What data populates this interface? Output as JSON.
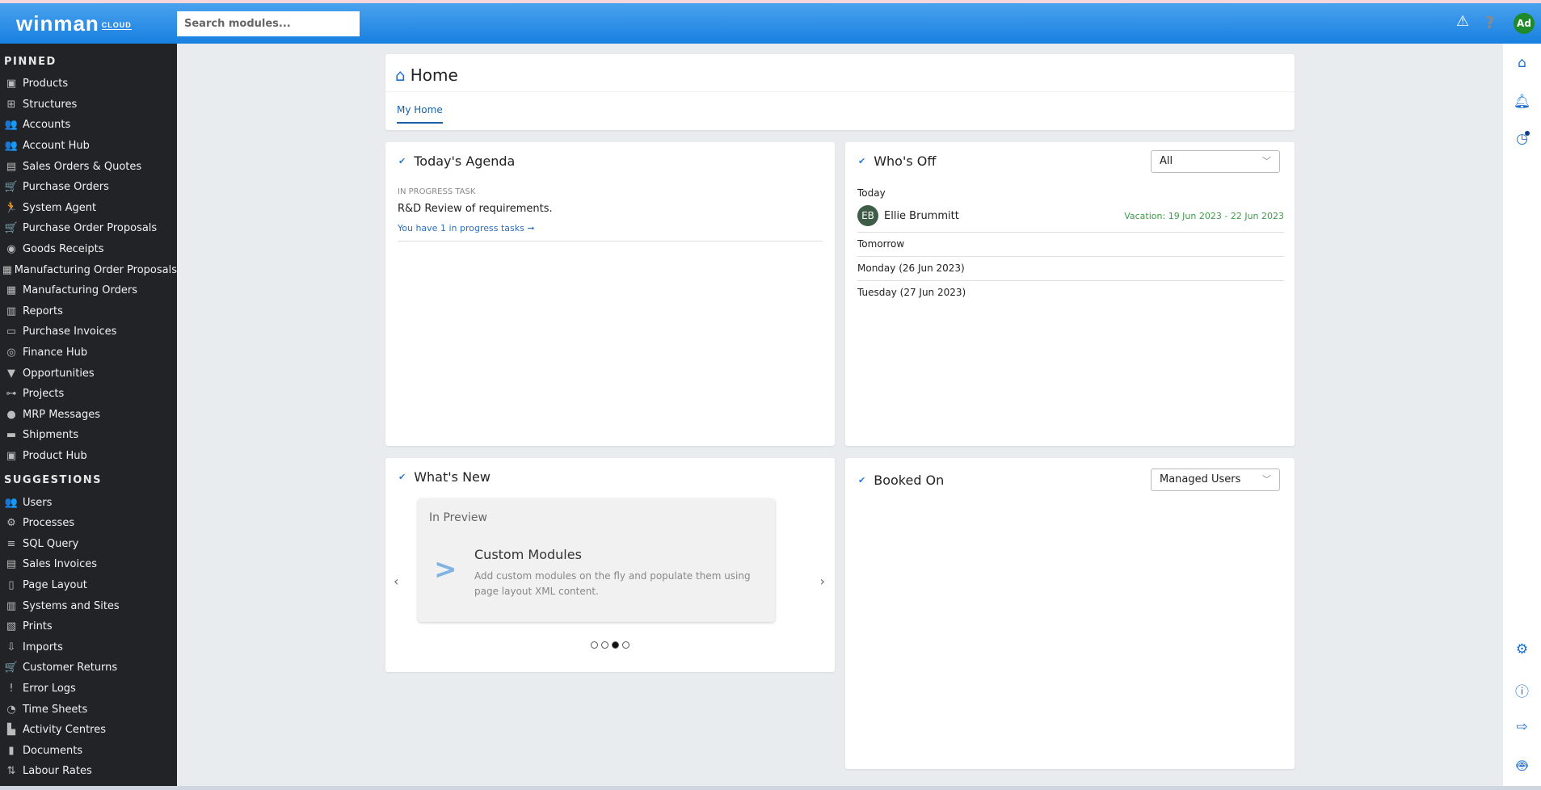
{
  "header": {
    "logo": "winman",
    "logo_sub": "CLOUD",
    "search_placeholder": "Search modules...",
    "avatar": "Ad",
    "icons": [
      "warning-icon",
      "help-icon"
    ]
  },
  "sidebar": {
    "pinned_label": "PINNED",
    "pinned": [
      {
        "label": "Products",
        "icon": "▣"
      },
      {
        "label": "Structures",
        "icon": "⊞"
      },
      {
        "label": "Accounts",
        "icon": "👥"
      },
      {
        "label": "Account Hub",
        "icon": "👥"
      },
      {
        "label": "Sales Orders & Quotes",
        "icon": "▤"
      },
      {
        "label": "Purchase Orders",
        "icon": "🛒"
      },
      {
        "label": "System Agent",
        "icon": "🏃"
      },
      {
        "label": "Purchase Order Proposals",
        "icon": "🛒"
      },
      {
        "label": "Goods Receipts",
        "icon": "◉"
      },
      {
        "label": "Manufacturing Order Proposals",
        "icon": "▦"
      },
      {
        "label": "Manufacturing Orders",
        "icon": "▦"
      },
      {
        "label": "Reports",
        "icon": "▥"
      },
      {
        "label": "Purchase Invoices",
        "icon": "▭"
      },
      {
        "label": "Finance Hub",
        "icon": "◎"
      },
      {
        "label": "Opportunities",
        "icon": "▼"
      },
      {
        "label": "Projects",
        "icon": "⊶"
      },
      {
        "label": "MRP Messages",
        "icon": "●"
      },
      {
        "label": "Shipments",
        "icon": "▬"
      },
      {
        "label": "Product Hub",
        "icon": "▣"
      }
    ],
    "suggestions_label": "SUGGESTIONS",
    "suggestions": [
      {
        "label": "Users",
        "icon": "👥"
      },
      {
        "label": "Processes",
        "icon": "⚙"
      },
      {
        "label": "SQL Query",
        "icon": "≡"
      },
      {
        "label": "Sales Invoices",
        "icon": "▤"
      },
      {
        "label": "Page Layout",
        "icon": "▯"
      },
      {
        "label": "Systems and Sites",
        "icon": "▥"
      },
      {
        "label": "Prints",
        "icon": "▧"
      },
      {
        "label": "Imports",
        "icon": "⇩"
      },
      {
        "label": "Customer Returns",
        "icon": "🛒"
      },
      {
        "label": "Error Logs",
        "icon": "!"
      },
      {
        "label": "Time Sheets",
        "icon": "◔"
      },
      {
        "label": "Activity Centres",
        "icon": "▙"
      },
      {
        "label": "Documents",
        "icon": "▮"
      },
      {
        "label": "Labour Rates",
        "icon": "⇅"
      }
    ]
  },
  "home": {
    "title": "Home",
    "tab": "My Home"
  },
  "agenda": {
    "title": "Today's Agenda",
    "label": "IN PROGRESS TASK",
    "task": "R&D Review of requirements.",
    "link": "You have 1 in progress tasks ➞"
  },
  "whos_off": {
    "title": "Who's Off",
    "filter": "All",
    "today": "Today",
    "person_initials": "EB",
    "person": "Ellie Brummitt",
    "vacation": "Vacation: 19 Jun 2023 - 22 Jun 2023",
    "tomorrow": "Tomorrow",
    "monday": "Monday (26 Jun 2023)",
    "tuesday": "Tuesday (27 Jun 2023)"
  },
  "whats_new": {
    "title": "What's New",
    "tag": "In Preview",
    "heading": "Custom Modules",
    "desc": "Add custom modules on the fly and populate them using page layout XML content.",
    "slides": 4,
    "active_slide": 3
  },
  "booked_on": {
    "title": "Booked On",
    "filter": "Managed Users"
  },
  "colors": {
    "accent": "#1a6fd0",
    "sidebar": "#222326",
    "vacation": "#3f9a4a"
  }
}
